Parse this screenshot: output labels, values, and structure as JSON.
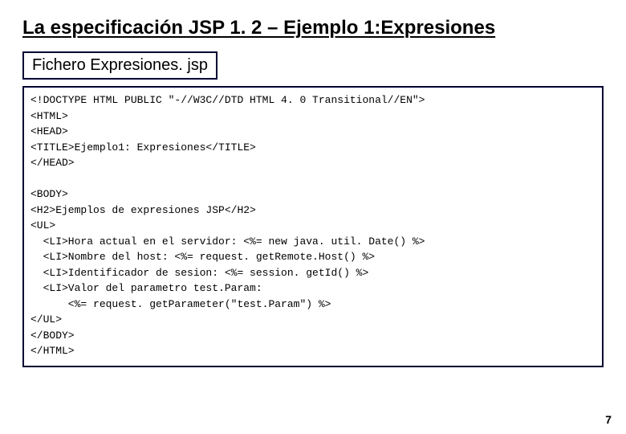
{
  "slide": {
    "title": "La especificación JSP 1. 2 – Ejemplo 1:Expresiones",
    "file_label": "Fichero Expresiones. jsp",
    "code": "<!DOCTYPE HTML PUBLIC \"-//W3C//DTD HTML 4. 0 Transitional//EN\">\n<HTML>\n<HEAD>\n<TITLE>Ejemplo1: Expresiones</TITLE>\n</HEAD>\n\n<BODY>\n<H2>Ejemplos de expresiones JSP</H2>\n<UL>\n  <LI>Hora actual en el servidor: <%= new java. util. Date() %>\n  <LI>Nombre del host: <%= request. getRemote.Host() %>\n  <LI>Identificador de sesion: <%= session. getId() %>\n  <LI>Valor del parametro test.Param:\n      <%= request. getParameter(\"test.Param\") %>\n</UL>\n</BODY>\n</HTML>",
    "page_number": "7"
  }
}
